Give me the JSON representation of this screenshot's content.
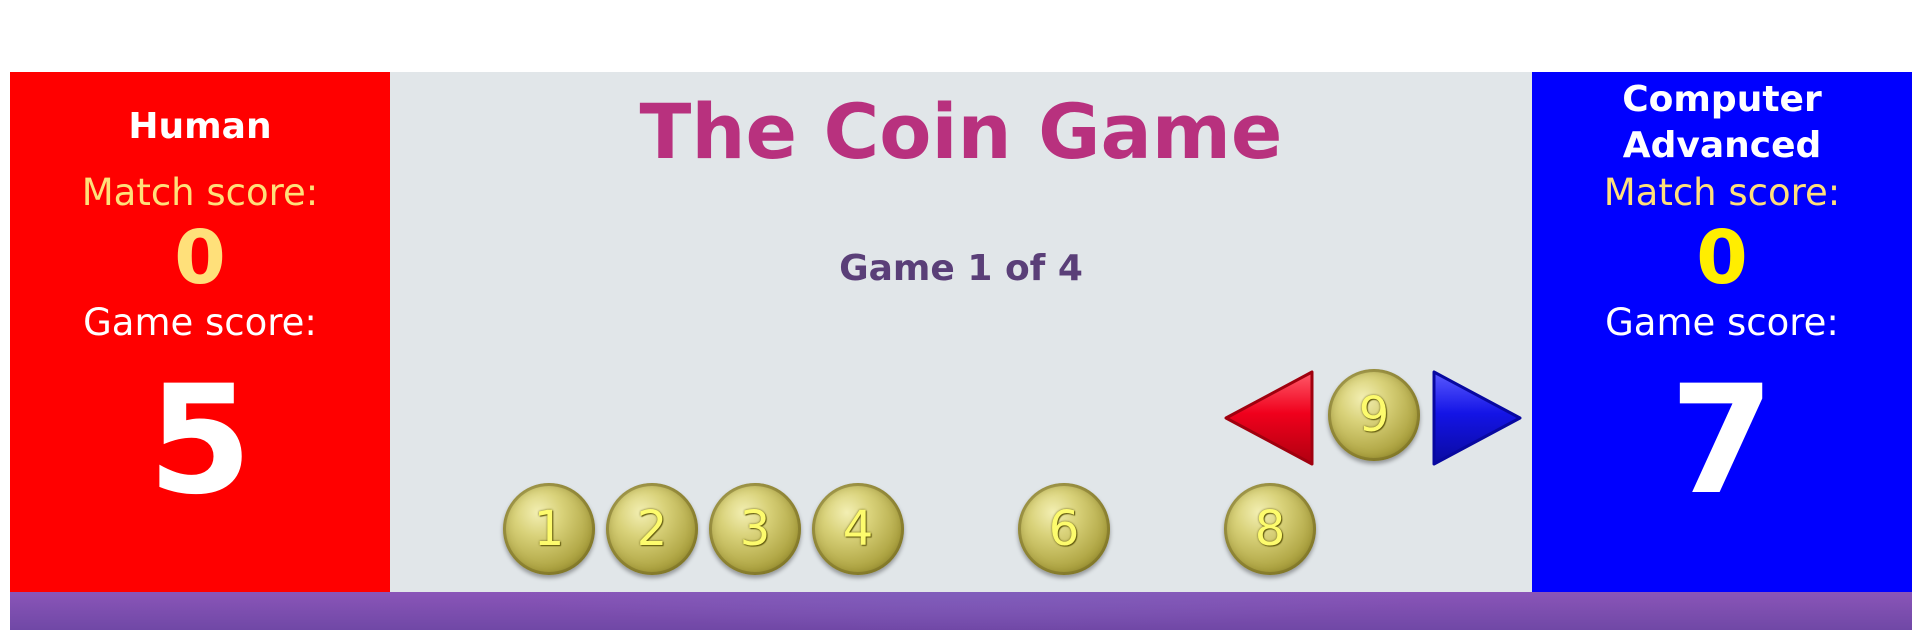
{
  "title": "The Coin Game",
  "game_info": "Game 1 of 4",
  "human": {
    "name": "Human",
    "match_label": "Match score:",
    "match_score": "0",
    "game_label": "Game score:",
    "game_score": "5",
    "panel_color": "#ff0000",
    "match_score_color": "#ffe07a"
  },
  "computer": {
    "name_line1": "Computer",
    "name_line2": "Advanced",
    "match_label": "Match score:",
    "match_score": "0",
    "game_label": "Game score:",
    "game_score": "7",
    "panel_color": "#0000ff",
    "match_score_color": "#ffee00"
  },
  "board_coins": [
    "1",
    "2",
    "3",
    "4",
    "6",
    "8"
  ],
  "current_coin": "9",
  "controls": {
    "left_arrow_icon": "red-left-triangle",
    "right_arrow_icon": "blue-right-triangle"
  },
  "colors": {
    "title": "#b8317e",
    "board_background": "#e1e6e9",
    "bottom_bar": "#7b4db0"
  }
}
